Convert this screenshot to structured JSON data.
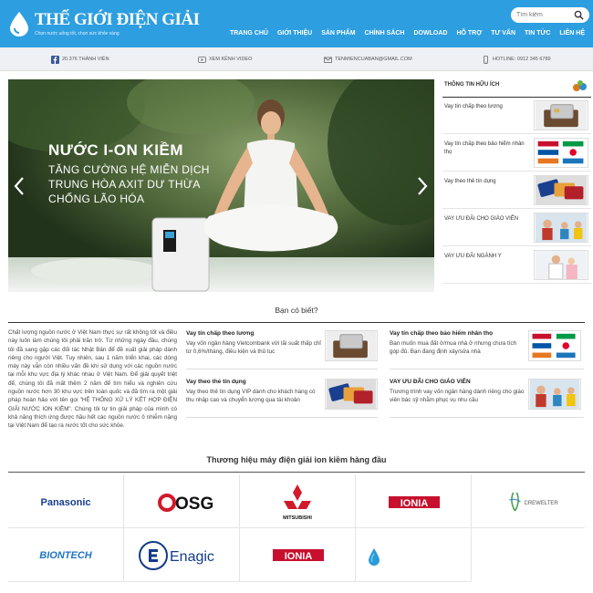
{
  "header": {
    "brand": "THẾ GIỚI ĐIỆN GIẢI",
    "slogan": "Chọn nước uống tốt, chọn sức khỏe vàng",
    "search_placeholder": "Tìm kiếm",
    "nav": [
      "TRANG CHỦ",
      "GIỚI THIỆU",
      "SẢN PHẨM",
      "CHÍNH SÁCH",
      "DOWLOAD",
      "HỖ TRỢ",
      "TƯ VẤN",
      "TIN TỨC",
      "LIÊN HỆ"
    ],
    "accent": "#2d9ee0"
  },
  "contact": {
    "facebook": "20.376 THÀNH VIÊN",
    "youtube": "XEM KÊNH VIDEO",
    "email": "TENMIENCUABAN@GMAIL.COM",
    "hotline": "HOTLINE: 0912 345 6789"
  },
  "hero": {
    "headline": "NƯỚC I-ON KIỀM",
    "lines": [
      "TĂNG CƯỜNG HỆ MIỄN DỊCH",
      "TRUNG HÒA AXIT DƯ THỪA",
      "CHỐNG LÃO HÓA"
    ]
  },
  "sidebar": {
    "title": "THÔNG TIN HỮU ÍCH",
    "items": [
      {
        "label": "Vay tín chấp theo lương",
        "icon": "card-in-wallet"
      },
      {
        "label": "Vay tín chấp theo bảo hiểm nhân thọ",
        "icon": "insurance-logos"
      },
      {
        "label": "Vay theo thẻ tín dụng",
        "icon": "credit-cards"
      },
      {
        "label": "VAY ƯU ĐÃI CHO GIÁO VIÊN",
        "icon": "teacher-classroom"
      },
      {
        "label": "VAY ƯU ĐÃI NGÀNH Y",
        "icon": "doctor"
      }
    ]
  },
  "dyk": {
    "title": "Bạn có biết?"
  },
  "intro": "Chất lượng nguồn nước ở Việt Nam thực sự rất không tốt và điều này luôn làm chúng tôi phải trăn trở. Từ những ngày đầu, chúng tôi đã sang gặp các đối tác Nhật Bản để đề xuất giải pháp dành riêng cho người Việt. Tuy nhiên, sau 1 năm triển khai, các dòng máy này vẫn còn nhiều vấn đề khi sử dụng với các nguồn nước tại mỗi khu vực địa lý khác nhau ở Việt Nam. Để giải quyết triệt để, chúng tôi đã mất thêm 2 năm để tìm hiểu và nghiên cứu nguồn nước hơn 30 khu vực trên toàn quốc và đã tìm ra một giải pháp hoàn hảo với tên gọi \"HỆ THỐNG XỬ LÝ KẾT HỢP ĐIỆN GIẢI NƯỚC ION KIỀM\". Chúng tôi tự tin giải pháp của mình có khả năng thích ứng được hầu hết các nguồn nước ô nhiễm nặng tại Việt Nam để tạo ra nước tốt cho sức khỏe.",
  "news": [
    {
      "title": "Vay tín chấp theo lương",
      "desc": "Vay vốn ngân hàng Vietcombank với lãi suất thấp chỉ từ 0,6%/tháng, điều kiện và thủ tục"
    },
    {
      "title": "Vay tín chấp theo bảo hiểm nhân thọ",
      "desc": "Bạn muốn mua đất ở/mua nhà ở nhưng chưa tích góp đủ. Bạn đang định xây/sửa nhà"
    },
    {
      "title": "Vay theo thẻ tín dụng",
      "desc": "Vay theo thẻ tín dụng VIP dành cho khách hàng có thu nhập cao và chuyển lương qua tài khoản"
    },
    {
      "title": "VAY ƯU ĐÃI CHO GIÁO VIÊN",
      "desc": "Trương trình vay vốn ngân hàng dành riêng cho giáo viên bác sỹ nhằm phục vụ nhu cầu"
    }
  ],
  "brands": {
    "title": "Thương hiệu máy điện giải ion kiềm hàng đầu",
    "items": [
      "Panasonic",
      "OSG",
      "MITSUBISHI",
      "IONIA",
      "CREWELTER",
      "BIONTECH",
      "Enagic",
      "IONIA",
      "drop"
    ]
  }
}
